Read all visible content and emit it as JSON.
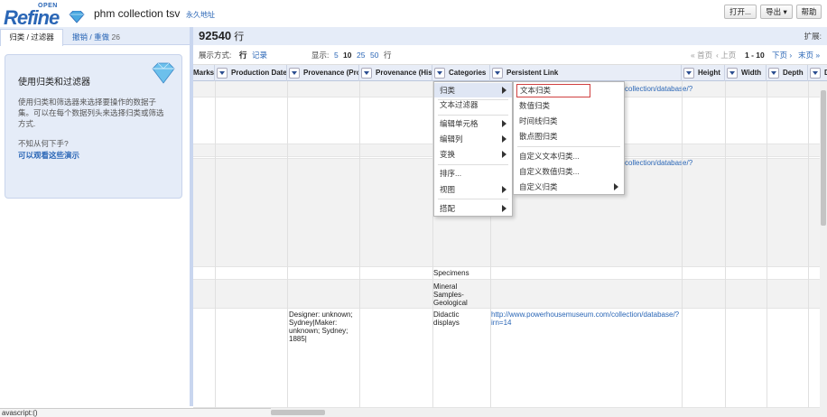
{
  "header": {
    "logo_open": "OPEN",
    "logo_refine": "Refine",
    "project_title": "phm collection tsv",
    "permalink": "永久地址",
    "btn_open": "打开...",
    "btn_export": "导出 ▾",
    "btn_help": "帮助"
  },
  "left": {
    "tab_facet": "归类 / 过滤器",
    "undo": "撤销",
    "undo_sep": " / ",
    "redo": "重做",
    "redo_count": "26",
    "box_title": "使用归类和过滤器",
    "box_desc": "使用归类和筛选器来选择要操作的数据子集。可以在每个数据列头来选择归类或筛选方式.",
    "box_question": "不知从何下手?",
    "box_demo": "可以观看这些演示"
  },
  "right": {
    "row_count": "92540",
    "row_unit": " 行",
    "extend": "扩展:",
    "show_as": "展示方式:",
    "show_rows": "行",
    "show_records": "记录",
    "show_label": "显示:",
    "sizes": [
      "5",
      "10",
      "25",
      "50"
    ],
    "sizes_unit": "行",
    "first": "« 首页",
    "prev": "‹ 上页",
    "range": "1 - 10",
    "next": "下页 ›",
    "last": "末页 »"
  },
  "columns": [
    "Marks",
    "Production Date",
    "Provenance (Pro",
    "Provenance (His",
    "Categories",
    "Persistent Link",
    "Height",
    "Width",
    "Depth",
    "D"
  ],
  "rows": {
    "r1_link": "collection/database/?",
    "r5_link": "collection/database/?",
    "specimens": "Specimens",
    "mineral": "Mineral Samples-Geological",
    "designer": "Designer: unknown; Sydney|Maker: unknown; Sydney; 1885|",
    "didactic": "Didactic displays",
    "full_link": "http://www.powerhousemuseum.com/collection/database/?irn=14"
  },
  "menu_main": [
    {
      "label": "归类",
      "sub": true
    },
    {
      "label": "文本过滤器",
      "sub": false
    },
    {
      "label": "编辑单元格",
      "sub": true
    },
    {
      "label": "编辑列",
      "sub": true
    },
    {
      "label": "变换",
      "sub": true
    },
    {
      "label": "排序...",
      "sub": false
    },
    {
      "label": "视图",
      "sub": true
    },
    {
      "label": "搭配",
      "sub": true
    }
  ],
  "menu_facet": [
    {
      "label": "文本归类"
    },
    {
      "label": "数值归类"
    },
    {
      "label": "时间线归类"
    },
    {
      "label": "散点图归类"
    },
    {
      "label": "自定义文本归类..."
    },
    {
      "label": "自定义数值归类..."
    },
    {
      "label": "自定义归类"
    }
  ],
  "status": "avascript:()"
}
